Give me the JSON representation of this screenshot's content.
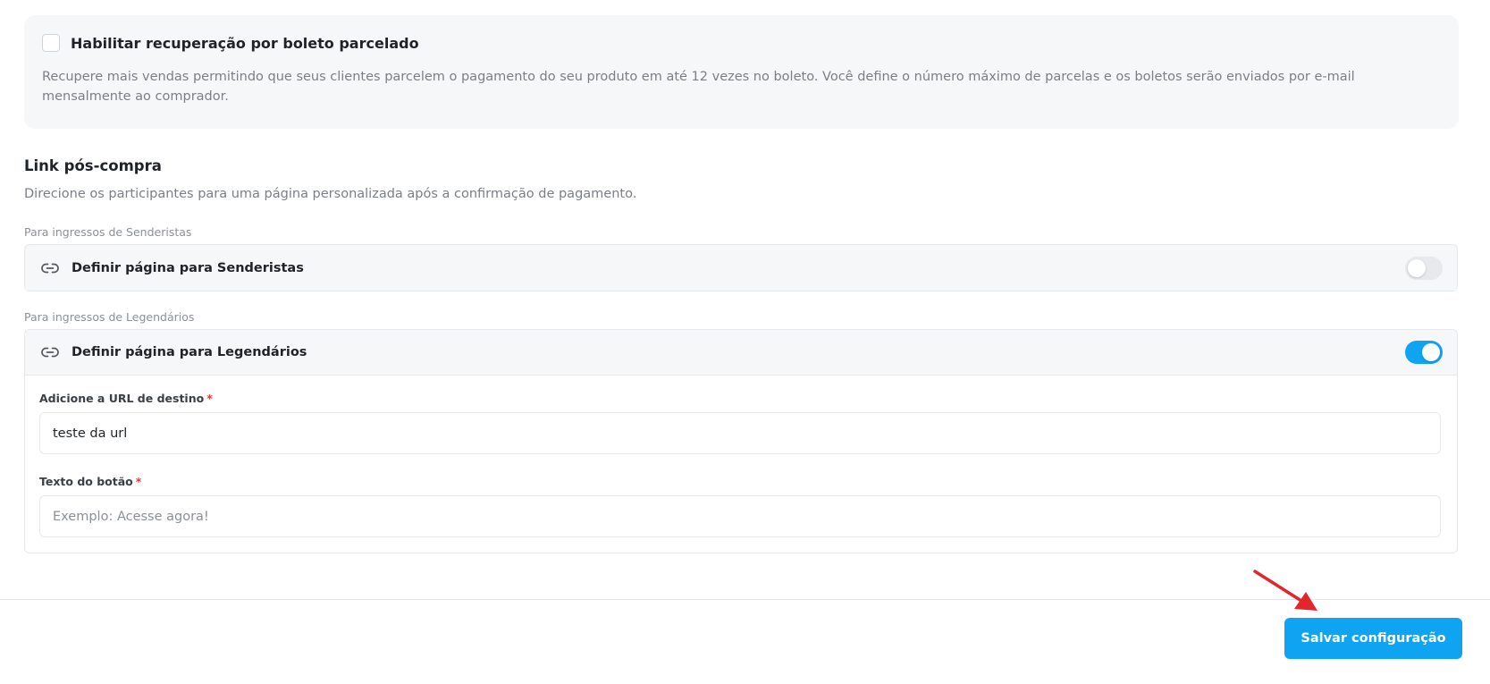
{
  "boleto": {
    "title": "Habilitar recuperação por boleto parcelado",
    "description": "Recupere mais vendas permitindo que seus clientes parcelem o pagamento do seu produto em até 12 vezes no boleto. Você define o número máximo de parcelas e os boletos serão enviados por e-mail mensalmente ao comprador.",
    "checked": false
  },
  "post_purchase": {
    "title": "Link pós-compra",
    "description": "Direcione os participantes para uma página personalizada após a confirmação de pagamento.",
    "groups": [
      {
        "label": "Para ingressos de Senderistas",
        "toggle_label": "Definir página para Senderistas",
        "enabled": false,
        "icon": "link-icon"
      },
      {
        "label": "Para ingressos de Legendários",
        "toggle_label": "Definir página para Legendários",
        "enabled": true,
        "icon": "link-icon",
        "url_field": {
          "label": "Adicione a URL de destino",
          "required_mark": "*",
          "value": "teste da url"
        },
        "button_text_field": {
          "label": "Texto do botão",
          "required_mark": "*",
          "value": "",
          "placeholder": "Exemplo: Acesse agora!"
        }
      }
    ]
  },
  "footer": {
    "save_label": "Salvar configuração"
  },
  "colors": {
    "accent": "#0fa4f2",
    "required": "#e0363c",
    "annotation_arrow": "#e3262b"
  }
}
